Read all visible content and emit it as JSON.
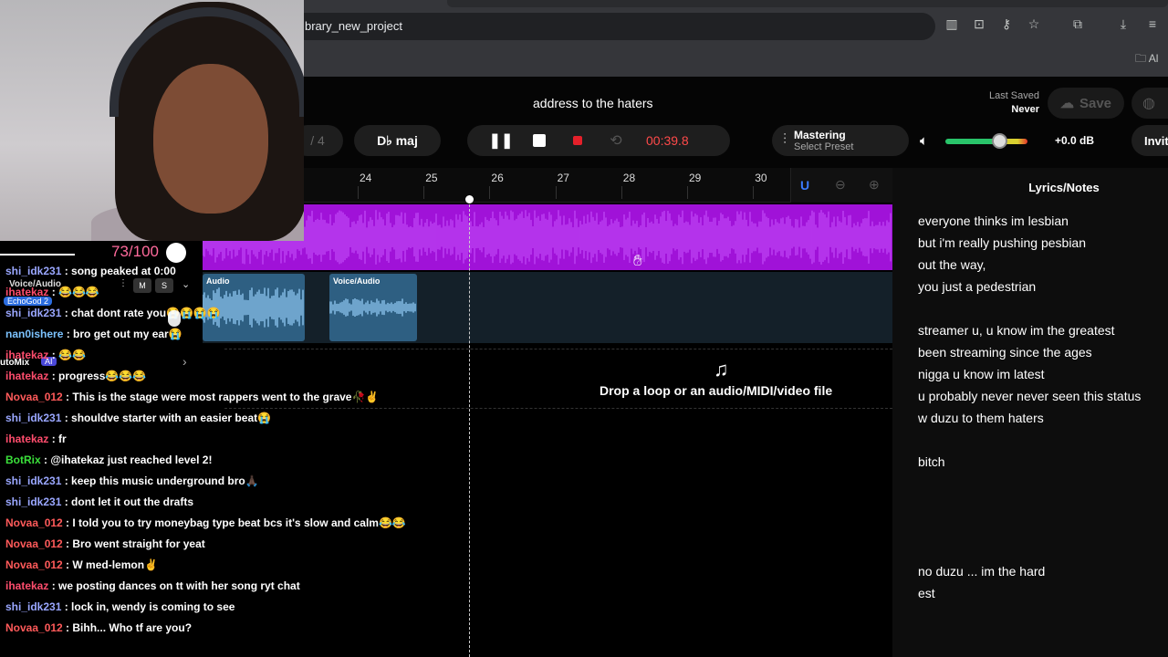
{
  "browser": {
    "url": "brary_new_project",
    "bookmark_folder": "Al"
  },
  "header": {
    "project_title": "address to the haters",
    "last_saved_label": "Last Saved",
    "last_saved_value": "Never",
    "save_label": "Save",
    "invite_label": "Invit"
  },
  "transport": {
    "bar_count": "/ 4",
    "key": "D♭ maj",
    "time": "00:39.8"
  },
  "mastering": {
    "title": "Mastering",
    "subtitle": "Select Preset"
  },
  "volume": {
    "level": 0.68,
    "db_label": "+0.0 dB"
  },
  "timeline": {
    "ruler_numbers": [
      "24",
      "25",
      "26",
      "27",
      "28",
      "29",
      "30"
    ],
    "clip_labels": [
      "Audio",
      "Voice/Audio"
    ],
    "drop_text": "Drop a loop or an audio/MIDI/video file"
  },
  "lyrics": {
    "title": "Lyrics/Notes",
    "lines": [
      "everyone thinks im lesbian",
      "but i'm really pushing pesbian",
      "out the way,",
      "you just a pedestrian",
      "",
      "streamer u, u know im the greatest",
      "been streaming since the ages",
      "nigga u know im latest",
      "u probably never never seen this status",
      "w duzu to them haters",
      "",
      "bitch",
      "",
      "",
      "",
      "",
      "no duzu ... im the hard",
      "est"
    ]
  },
  "stream": {
    "goal": "73/100",
    "track_name": "Voice/Audio",
    "echo_label": "EchoGod 2",
    "automix_label": "utoMix",
    "ai_label": "AI",
    "mute_label": "M",
    "solo_label": "S"
  },
  "chat": [
    {
      "user": "shi_idk231",
      "color": "#9aa7ff",
      "text": ": song peaked at 0:00"
    },
    {
      "user": "ihatekaz",
      "color": "#ff4d6d",
      "text": ": 😂😂😂"
    },
    {
      "user": "shi_idk231",
      "color": "#9aa7ff",
      "text": ": chat dont rate you😭😭😭😭"
    },
    {
      "user": "nan0ishere",
      "color": "#7cc3ff",
      "text": ": bro get out my ear😭"
    },
    {
      "user": "ihatekaz",
      "color": "#ff4d6d",
      "text": ": 😂😂"
    },
    {
      "user": "ihatekaz",
      "color": "#ff4d6d",
      "text": ": progress😂😂😂"
    },
    {
      "user": "Novaa_012",
      "color": "#ff5a5a",
      "text": ": This is the stage were most rappers went to the grave🥀✌"
    },
    {
      "user": "shi_idk231",
      "color": "#9aa7ff",
      "text": ": shouldve starter with an easier beat😭"
    },
    {
      "user": "ihatekaz",
      "color": "#ff4d6d",
      "text": ": fr"
    },
    {
      "user": "BotRix",
      "color": "#3be03b",
      "text": ": @ihatekaz just reached level 2!"
    },
    {
      "user": "shi_idk231",
      "color": "#9aa7ff",
      "text": ": keep this music underground bro🙏🏿"
    },
    {
      "user": "shi_idk231",
      "color": "#9aa7ff",
      "text": ": dont let it out the drafts"
    },
    {
      "user": "Novaa_012",
      "color": "#ff5a5a",
      "text": ": I told you to try moneybag type beat bcs it's slow and calm😂😂"
    },
    {
      "user": "Novaa_012",
      "color": "#ff5a5a",
      "text": ": Bro went straight for yeat"
    },
    {
      "user": "Novaa_012",
      "color": "#ff5a5a",
      "text": ": W med-lemon✌"
    },
    {
      "user": "ihatekaz",
      "color": "#ff4d6d",
      "text": ": we posting dances on tt with her song ryt chat"
    },
    {
      "user": "shi_idk231",
      "color": "#9aa7ff",
      "text": ": lock in, wendy is coming to see"
    },
    {
      "user": "Novaa_012",
      "color": "#ff5a5a",
      "text": ": Bihh... Who tf are you?"
    }
  ],
  "colors": {
    "clip_purple": "#a012d8",
    "clip_blue": "#2e5f82",
    "record_red": "#e5202a",
    "time_red": "#ff4a4a",
    "goal_pink": "#ff6a9c"
  }
}
